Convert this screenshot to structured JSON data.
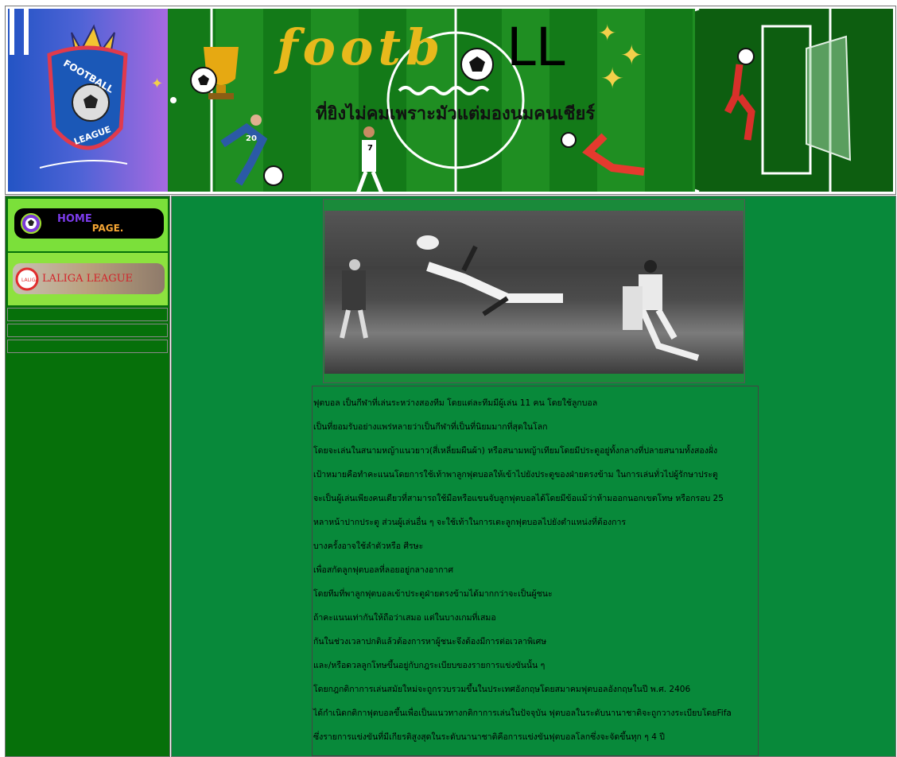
{
  "banner": {
    "logo_top": "FOOTBALL",
    "logo_bottom": "LEAGUE",
    "title_colored": "footb",
    "title_plain": "LL",
    "tagline": "ที่ยิงไม่คมเพราะมัวแต่มองนมคนเชียร์",
    "jersey_number_1": "20",
    "jersey_number_2": "7",
    "colors": {
      "field": "#137a18",
      "logo_bg": "#4e63d6",
      "title_gold": "#e7b91c",
      "title_pink": "#b3316e"
    }
  },
  "sidebar": {
    "home_button": {
      "label_1": "HOME",
      "label_2": "PAGE.",
      "icon": "soccer-ball-icon"
    },
    "laliga_button": {
      "label": "LALIGA LEAGUE",
      "icon": "laliga-logo-icon"
    },
    "links": [
      "",
      "",
      ""
    ]
  },
  "main": {
    "photo": {
      "description_icon": "bicycle-kick-photo"
    },
    "paragraphs": [
      "ฟุตบอล เป็นกีฬาที่เล่นระหว่างสองทีม โดยแต่ละทีมมีผู้เล่น 11 คน โดยใช้ลูกบอล",
      "เป็นที่ยอมรับอย่างแพร่หลายว่าเป็นกีฬาที่เป็นที่นิยมมากที่สุดในโลก",
      "โดยจะเล่นในสนามหญ้าแนวยาว(สี่เหลี่ยมผืนผ้า) หรือสนามหญ้าเทียมโดยมีประตูอยู่ทั้งกลางที่ปลายสนามทั้งสองฝั่ง",
      "เป้าหมายคือทำคะแนนโดยการใช้เท้าพาลูกฟุตบอลให้เข้าไปยังประตูของฝ่ายตรงข้าม ในการเล่นทั่วไปผู้รักษาประตู",
      "จะเป็นผู้เล่นเพียงคนเดียวที่สามารถใช้มือหรือแขนจับลูกฟุตบอลได้โดยมีข้อแม้ว่าห้ามออกนอกเขตโทษ หรือกรอบ 25",
      "หลาหน้าปากประตู ส่วนผู้เล่นอื่น ๆ จะใช้เท้าในการเตะลูกฟุตบอลไปยังตำแหน่งที่ต้องการ",
      "บางครั้งอาจใช้ลำตัวหรือ ศีรษะ",
      "เพื่อสกัดลูกฟุตบอลที่ลอยอยู่กลางอากาศ",
      "โดยทีมที่พาลูกฟุตบอลเข้าประตูฝ่ายตรงข้ามได้มากกว่าจะเป็นผู้ชนะ",
      "ถ้าคะแนนเท่ากันให้ถือว่าเสมอ แต่ในบางเกมที่เสมอ",
      "กันในช่วงเวลาปกติแล้วต้องการหาผู้ชนะจึงต้องมีการต่อเวลาพิเศษ",
      "และ/หรือดวลลูกโทษขึ้นอยู่กับกฎระเบียบของรายการแข่งขันนั้น ๆ",
      "โดยกฎกติกาการเล่นสมัยใหม่จะถูกรวบรวมขึ้นในประเทศอังกฤษโดยสมาคมฟุตบอลอังกฤษในปี พ.ศ. 2406",
      "ได้กำเนิดกติกาฟุตบอลขึ้นเพื่อเป็นแนวทางกติกาการเล่นในปัจจุบัน ฟุตบอลในระดับนานาชาติจะถูกวางระเบียบโดยFifa",
      "ซึ่งรายการแข่งขันที่มีเกียรติสูงสุดในระดับนานาชาติคือการแข่งขันฟุตบอลโลกซึ่งจะจัดขึ้นทุก ๆ 4 ปี"
    ]
  }
}
